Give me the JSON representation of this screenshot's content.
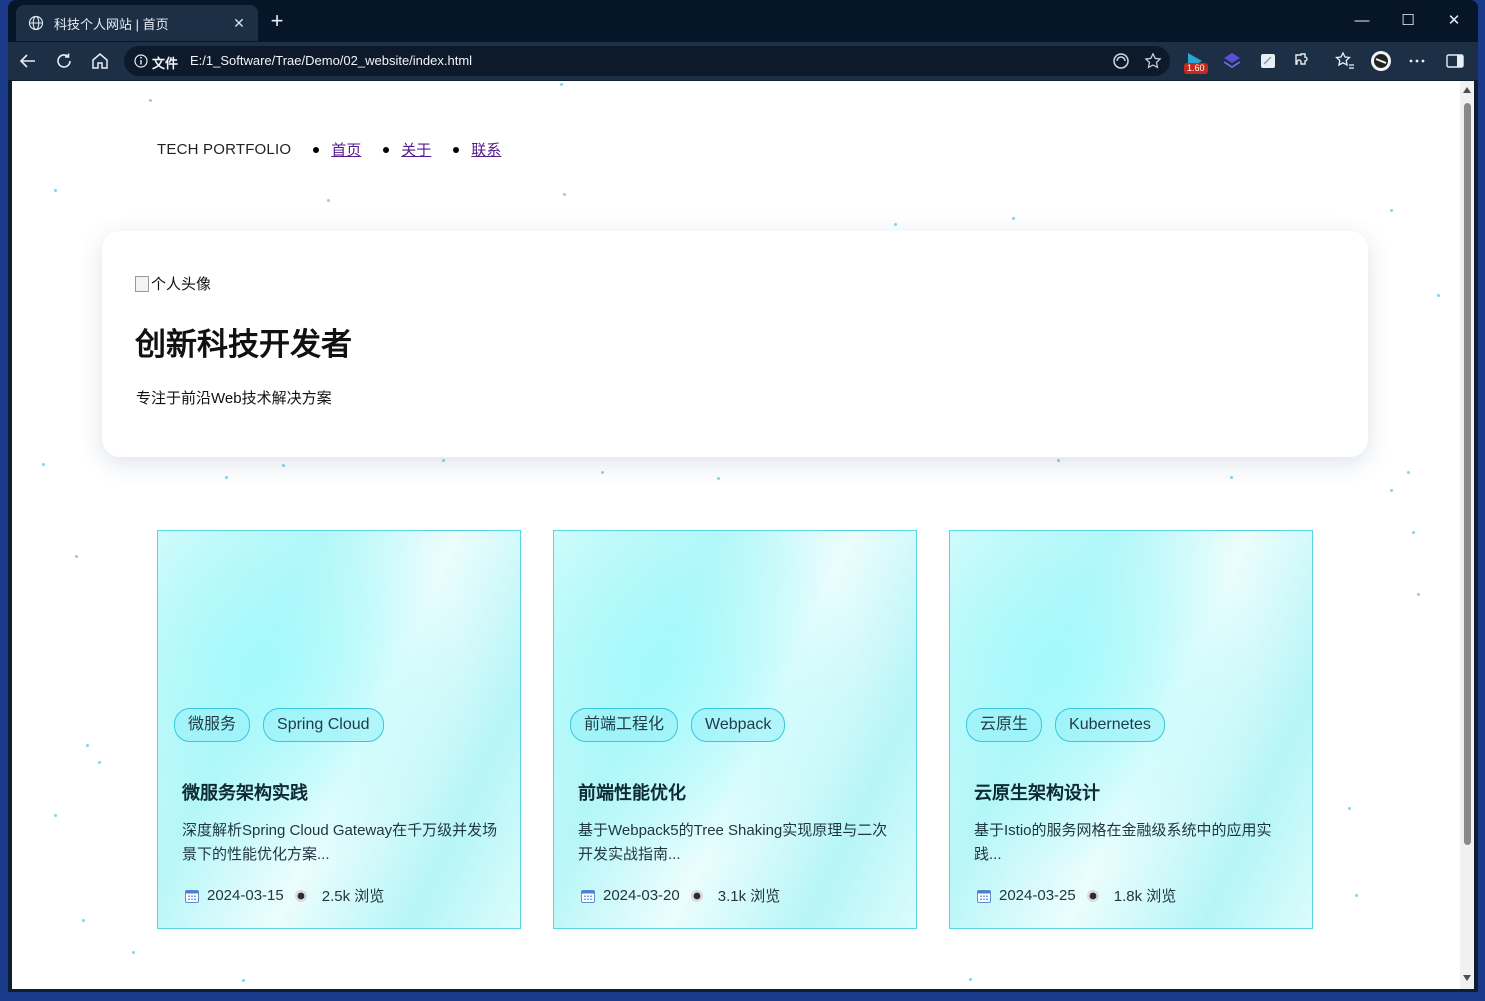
{
  "browser": {
    "tab_title": "科技个人网站 | 首页",
    "address_label": "文件",
    "url": "E:/1_Software/Trae/Demo/02_website/index.html",
    "extension_badge": "1.60",
    "accent": "#1d2f45"
  },
  "nav": {
    "brand": "TECH PORTFOLIO",
    "links": [
      "首页",
      "关于",
      "联系"
    ]
  },
  "hero": {
    "avatar_alt": "个人头像",
    "title": "创新科技开发者",
    "subtitle": "专注于前沿Web技术解决方案"
  },
  "cards": [
    {
      "tags": [
        "微服务",
        "Spring Cloud"
      ],
      "title": "微服务架构实践",
      "desc": "深度解析Spring Cloud Gateway在千万级并发场景下的性能优化方案...",
      "date": "2024-03-15",
      "views": "2.5k 浏览"
    },
    {
      "tags": [
        "前端工程化",
        "Webpack"
      ],
      "title": "前端性能优化",
      "desc": "基于Webpack5的Tree Shaking实现原理与二次开发实战指南...",
      "date": "2024-03-20",
      "views": "3.1k 浏览"
    },
    {
      "tags": [
        "云原生",
        "Kubernetes"
      ],
      "title": "云原生架构设计",
      "desc": "基于Istio的服务网格在金融级系统中的应用实践...",
      "date": "2024-03-25",
      "views": "1.8k 浏览"
    }
  ],
  "colors": {
    "card_border": "#59d3e6",
    "tag_border": "#36c8dc",
    "link": "#551a8b",
    "particle": "#56c7ee"
  }
}
